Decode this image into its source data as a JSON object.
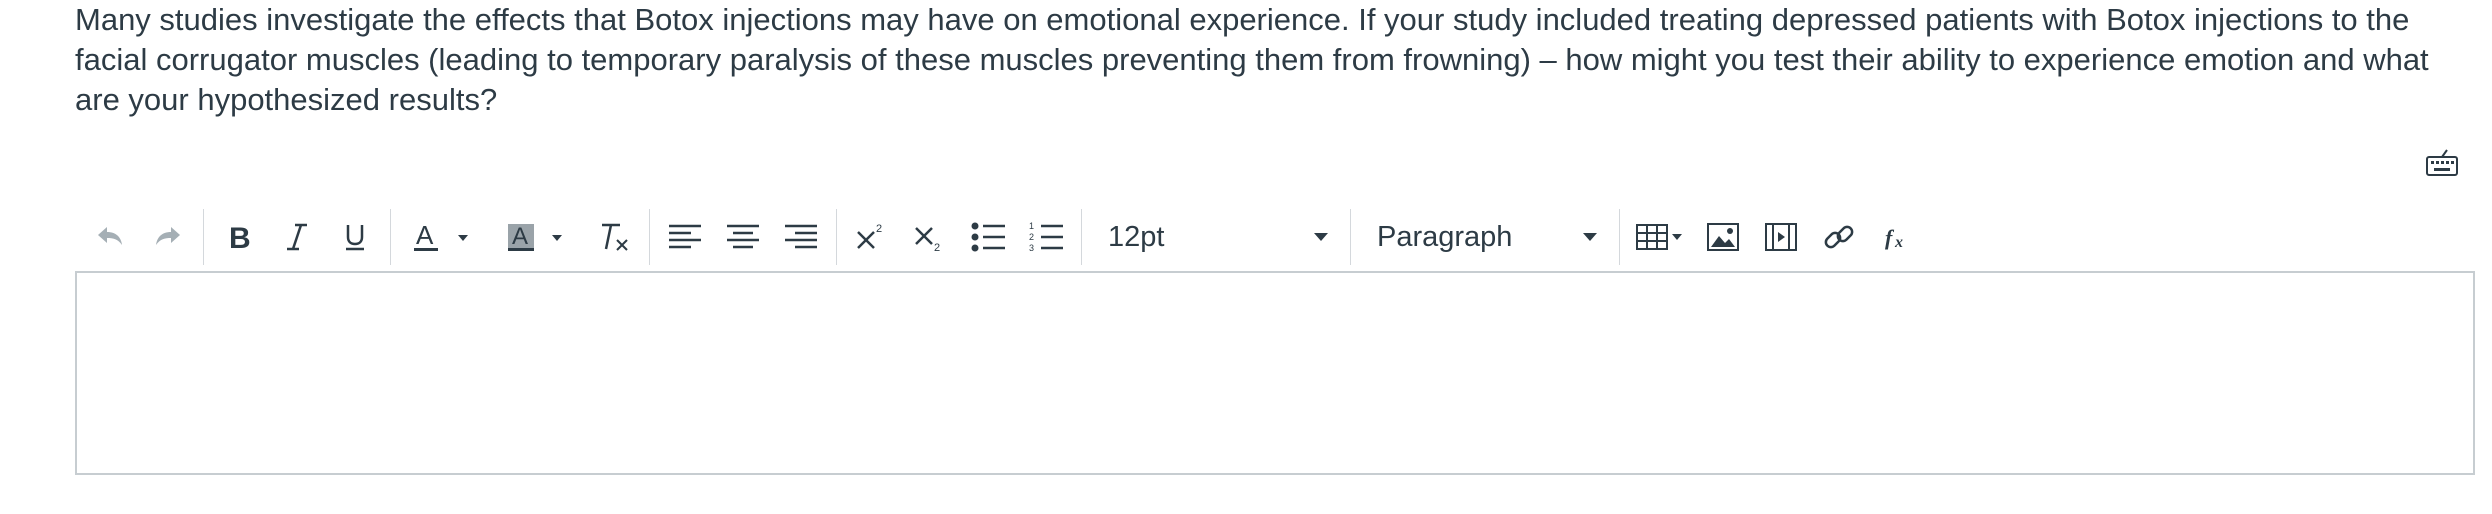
{
  "question": {
    "text": "Many studies investigate the effects that Botox injections may have on emotional experience.  If your study included treating depressed patients with Botox injections to the facial corrugator muscles (leading to temporary paralysis of these muscles preventing them from frowning) – how might you test their ability to experience emotion and what are your hypothesized results?"
  },
  "toolbar": {
    "font_size": "12pt",
    "block_format": "Paragraph",
    "icons": [
      "undo-icon",
      "redo-icon",
      "bold-icon",
      "italic-icon",
      "underline-icon",
      "text-color-icon",
      "background-color-icon",
      "clear-formatting-icon",
      "align-left-icon",
      "align-center-icon",
      "align-right-icon",
      "superscript-icon",
      "subscript-icon",
      "bullet-list-icon",
      "numbered-list-icon",
      "table-icon",
      "image-icon",
      "media-icon",
      "link-icon",
      "equation-icon",
      "keyboard-icon"
    ]
  },
  "colors": {
    "text": "#2d3b45",
    "disabled_icon": "#a5afb5",
    "border": "#c7cdd1",
    "background": "#ffffff"
  }
}
